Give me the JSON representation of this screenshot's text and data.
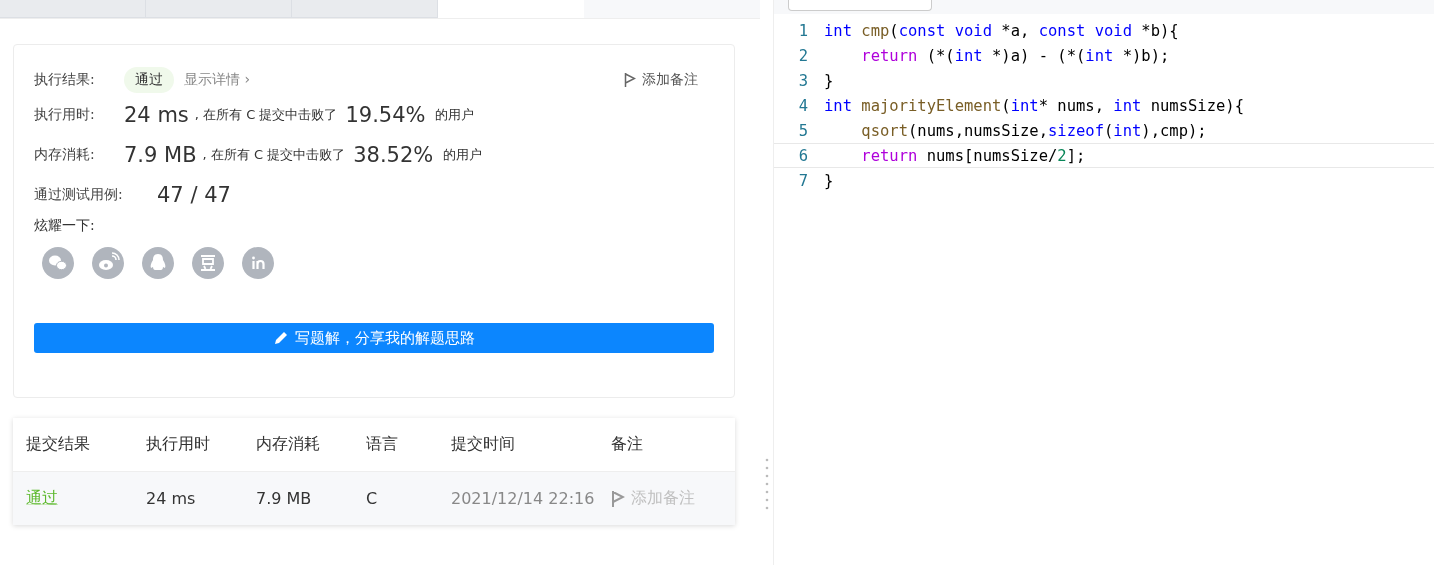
{
  "tabs": [
    {
      "selected": false
    },
    {
      "selected": false
    },
    {
      "selected": false
    },
    {
      "selected": true
    }
  ],
  "result": {
    "label": "执行结果:",
    "status": "通过",
    "details_link": "显示详情 ›",
    "note_button": "添加备注",
    "stats": [
      {
        "label": "执行用时:",
        "value": "24 ms",
        "text": ", 在所有 C 提交中击败了",
        "percent": "19.54%",
        "suffix": "的用户"
      },
      {
        "label": "内存消耗:",
        "value": "7.9 MB",
        "text": ", 在所有 C 提交中击败了",
        "percent": "38.52%",
        "suffix": "的用户"
      }
    ],
    "tests_label": "通过测试用例:",
    "tests_value": "47 / 47",
    "share_label": "炫耀一下:",
    "share_icons": [
      {
        "kind": "wechat"
      },
      {
        "kind": "weibo"
      },
      {
        "kind": "qq"
      },
      {
        "kind": "douban"
      },
      {
        "kind": "linkedin"
      }
    ],
    "solution_button": "写题解，分享我的解题思路"
  },
  "table": {
    "columns": [
      "提交结果",
      "执行用时",
      "内存消耗",
      "语言",
      "提交时间",
      "备注"
    ],
    "rows": [
      {
        "status": "通过",
        "time": "24 ms",
        "memory": "7.9 MB",
        "language": "C",
        "submitted": "2021/12/14 22:16",
        "note": "添加备注"
      }
    ]
  },
  "editor": {
    "lines": [
      {
        "number": "1",
        "current": false,
        "tokens": [
          {
            "text": "int",
            "color": "#0000ff"
          },
          {
            "text": " cmp",
            "color": "#795e26"
          },
          {
            "text": "(",
            "color": "#000000"
          },
          {
            "text": "const void",
            "color": "#0000ff"
          },
          {
            "text": " *a, ",
            "color": "#000000"
          },
          {
            "text": "const void",
            "color": "#0000ff"
          },
          {
            "text": " *b){",
            "color": "#000000"
          }
        ]
      },
      {
        "number": "2",
        "current": false,
        "tokens": [
          {
            "text": "    return",
            "color": "#af00db"
          },
          {
            "text": " (*(",
            "color": "#000000"
          },
          {
            "text": "int",
            "color": "#0000ff"
          },
          {
            "text": " *)a) - (*(",
            "color": "#000000"
          },
          {
            "text": "int",
            "color": "#0000ff"
          },
          {
            "text": " *)b);",
            "color": "#000000"
          }
        ]
      },
      {
        "number": "3",
        "current": false,
        "tokens": [
          {
            "text": "}",
            "color": "#000000"
          }
        ]
      },
      {
        "number": "4",
        "current": false,
        "tokens": [
          {
            "text": "int",
            "color": "#0000ff"
          },
          {
            "text": " majorityElement",
            "color": "#795e26"
          },
          {
            "text": "(",
            "color": "#000000"
          },
          {
            "text": "int",
            "color": "#0000ff"
          },
          {
            "text": "* nums, ",
            "color": "#000000"
          },
          {
            "text": "int",
            "color": "#0000ff"
          },
          {
            "text": " numsSize){",
            "color": "#000000"
          }
        ]
      },
      {
        "number": "5",
        "current": false,
        "tokens": [
          {
            "text": "    qsort",
            "color": "#795e26"
          },
          {
            "text": "(nums,numsSize,",
            "color": "#000000"
          },
          {
            "text": "sizeof",
            "color": "#0000ff"
          },
          {
            "text": "(",
            "color": "#000000"
          },
          {
            "text": "int",
            "color": "#0000ff"
          },
          {
            "text": "),cmp);",
            "color": "#000000"
          }
        ]
      },
      {
        "number": "6",
        "current": true,
        "tokens": [
          {
            "text": "    return",
            "color": "#af00db"
          },
          {
            "text": " nums[numsSize/",
            "color": "#000000"
          },
          {
            "text": "2",
            "color": "#098658"
          },
          {
            "text": "];",
            "color": "#000000"
          }
        ]
      },
      {
        "number": "7",
        "current": false,
        "tokens": [
          {
            "text": "}",
            "color": "#000000"
          }
        ]
      }
    ]
  }
}
